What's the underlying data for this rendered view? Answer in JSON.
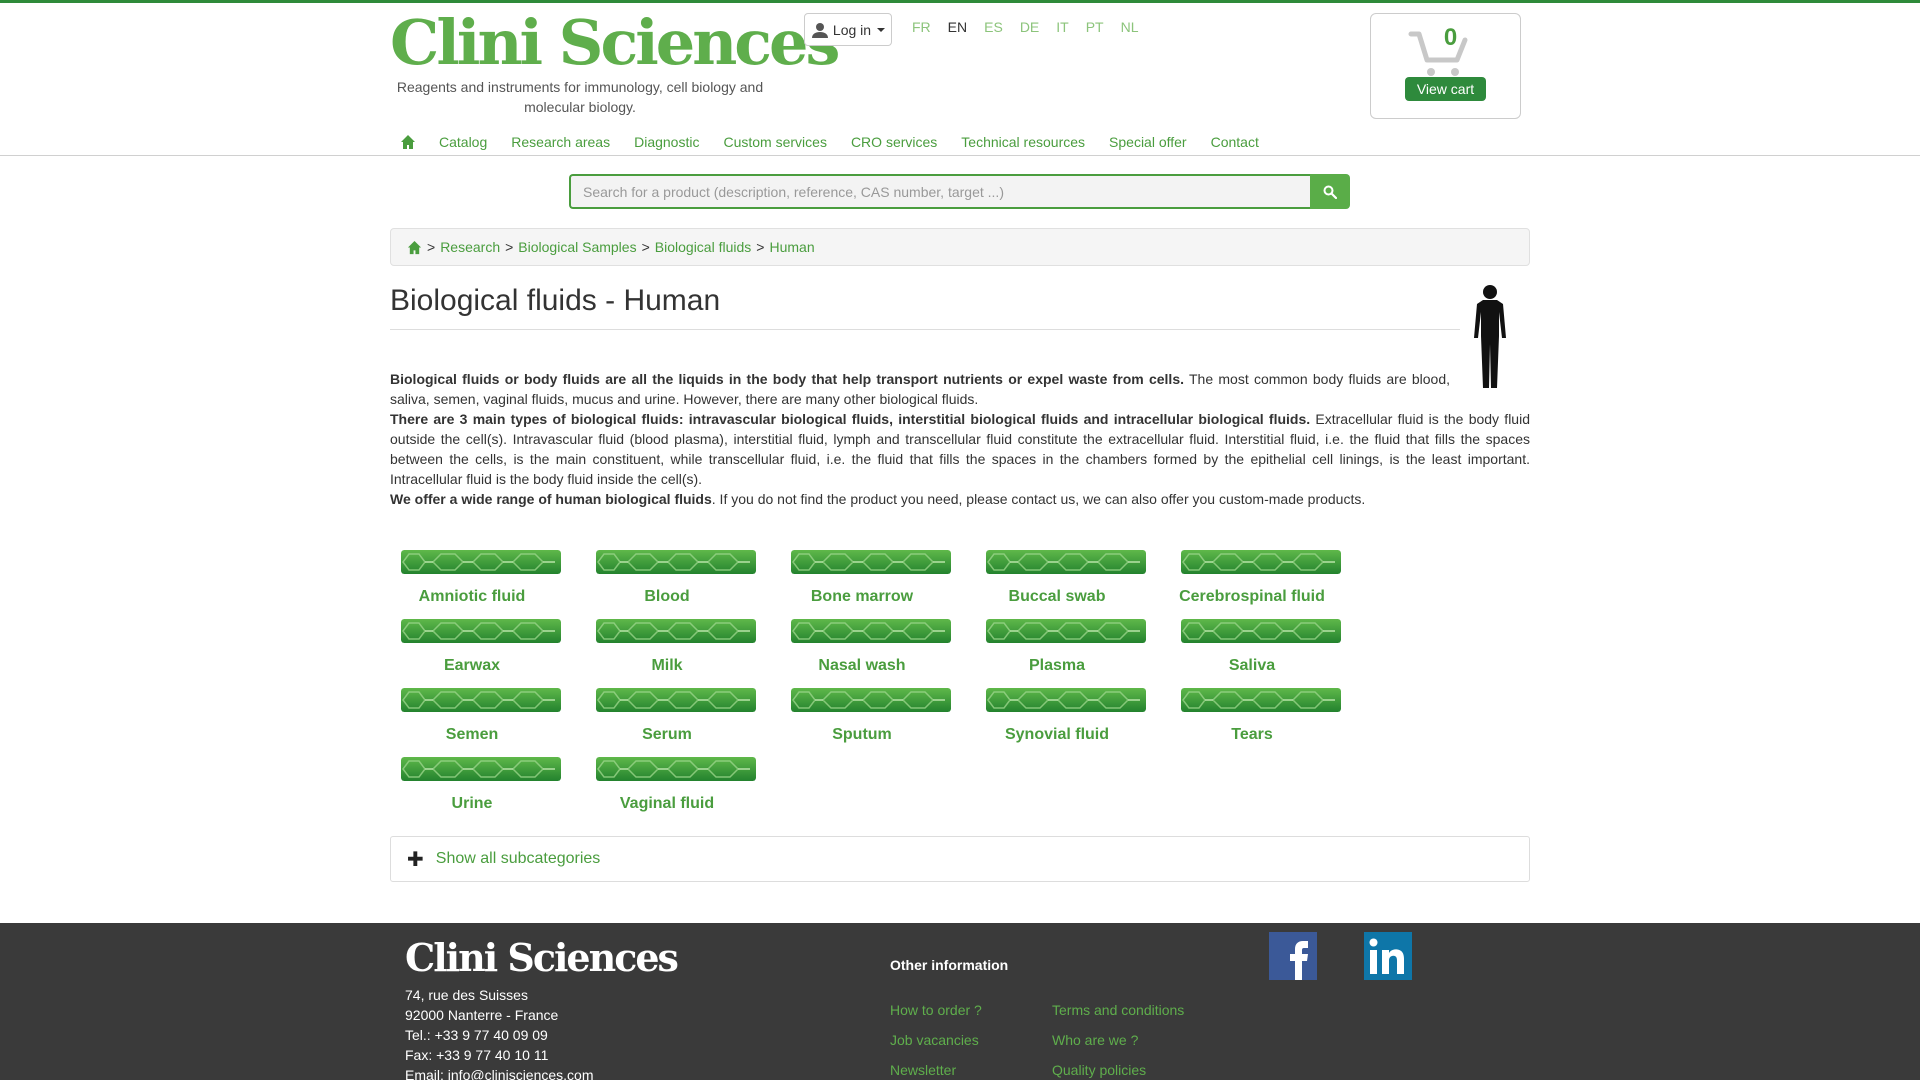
{
  "brand": {
    "logo_text": "Clini Sciences",
    "tagline": "Reagents and instruments for immunology, cell biology and molecular biology."
  },
  "header": {
    "login_label": "Log in",
    "languages": [
      "FR",
      "EN",
      "ES",
      "DE",
      "IT",
      "PT",
      "NL"
    ],
    "active_language": "EN"
  },
  "cart": {
    "count": "0",
    "button_label": "View cart"
  },
  "nav": {
    "items": [
      "Catalog",
      "Research areas",
      "Diagnostic",
      "Custom services",
      "CRO services",
      "Technical resources",
      "Special offer",
      "Contact"
    ]
  },
  "search": {
    "placeholder": "Search for a product (description, reference, CAS number, target ...)"
  },
  "breadcrumb": {
    "items": [
      "Research",
      "Biological Samples",
      "Biological fluids",
      "Human"
    ]
  },
  "page": {
    "title": "Biological fluids - Human",
    "p1_bold": "Biological fluids or body fluids are all the liquids in the body that help transport nutrients or expel waste from cells.",
    "p1_rest": " The most common body fluids are blood, saliva, semen, vaginal fluids, mucus and urine. However, there are many other biological fluids.",
    "p2_bold": "There are 3 main types of biological fluids: intravascular biological fluids, interstitial biological fluids and intracellular biological fluids.",
    "p2_rest": " Extracellular fluid is the body fluid outside the cell(s). Intravascular fluid (blood plasma), interstitial fluid, lymph and transcellular fluid constitute the extracellular fluid. Interstitial fluid, i.e. the fluid that fills the spaces between the cells, is the main constituent, while transcellular fluid, i.e. the fluid that fills the spaces in the chambers formed by the epithelial cell linings, is the least important. Intracellular fluid is the body fluid inside the cell(s).",
    "p3_bold": "We offer a wide range of human biological fluids",
    "p3_rest": ". If you do not find the product you need, please contact us, we can also offer you custom-made products."
  },
  "categories": [
    "Amniotic fluid",
    "Blood",
    "Bone marrow",
    "Buccal swab",
    "Cerebrospinal fluid",
    "Earwax",
    "Milk",
    "Nasal wash",
    "Plasma",
    "Saliva",
    "Semen",
    "Serum",
    "Sputum",
    "Synovial fluid",
    "Tears",
    "Urine",
    "Vaginal fluid"
  ],
  "show_all_label": "Show all subcategories",
  "footer": {
    "logo_text": "Clini Sciences",
    "address": [
      "74, rue des Suisses",
      "92000 Nanterre - France",
      "Tel.: +33 9 77 40 09 09",
      "Fax: +33 9 77 40 10 11",
      "Email: info@clinisciences.com"
    ],
    "other_title": "Other information",
    "links_col1": [
      "How to order ?",
      "Job vacancies",
      "Newsletter"
    ],
    "links_col2": [
      "Terms and conditions",
      "Who are we ?",
      "Quality policies"
    ]
  },
  "colors": {
    "brand_green": "#4a9d3e",
    "dark_green": "#2e8a3c",
    "footer_bg": "#3a3a3a",
    "facebook": "#3b5998",
    "linkedin": "#0e76a8"
  }
}
